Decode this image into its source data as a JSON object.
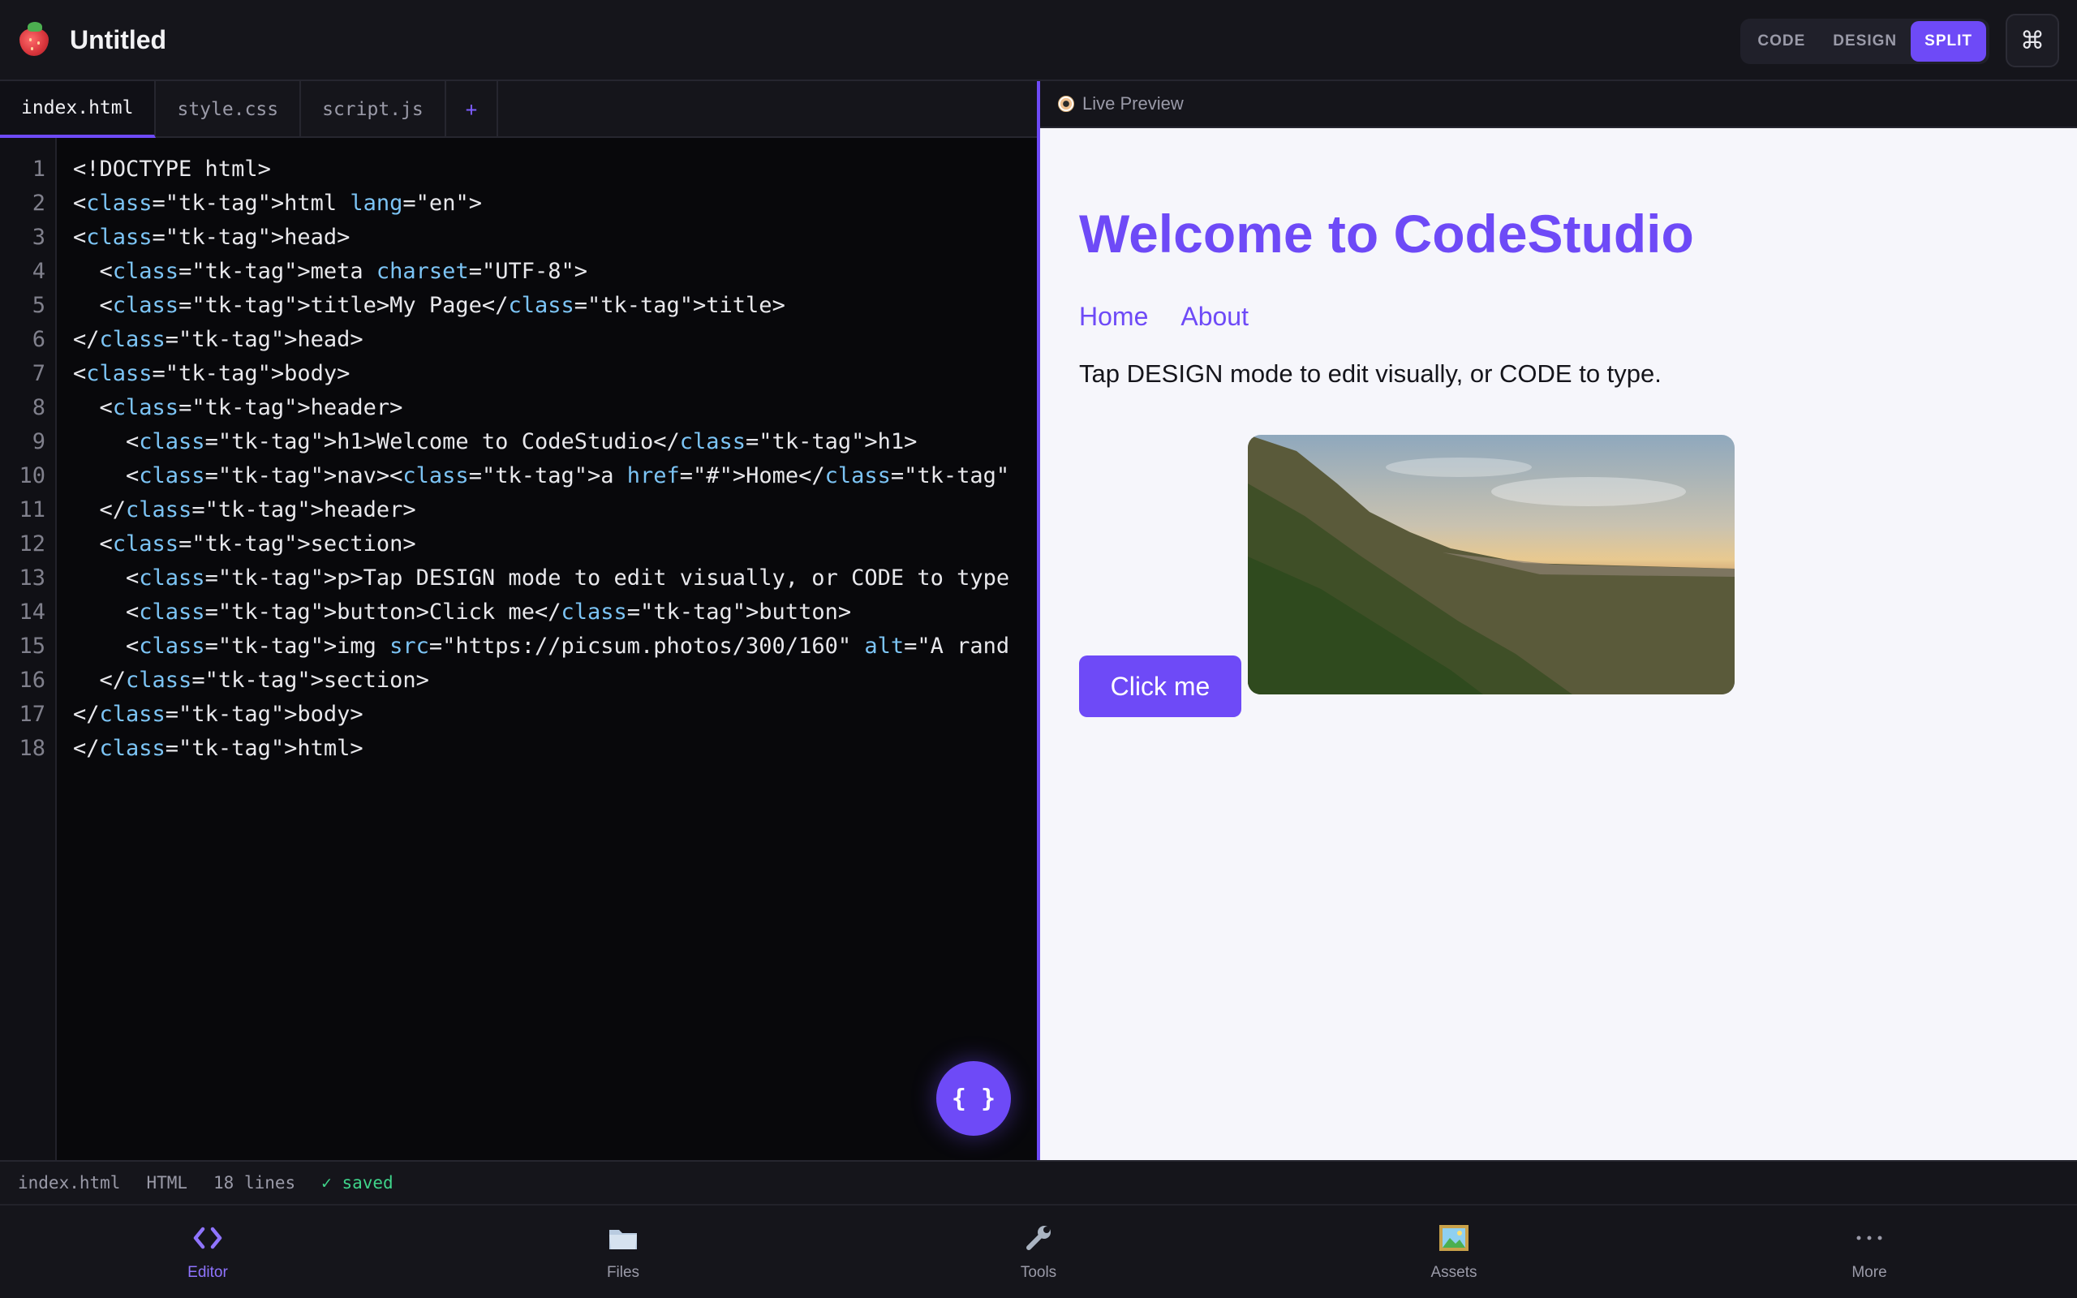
{
  "app": {
    "title": "Untitled"
  },
  "modes": {
    "code": "CODE",
    "design": "DESIGN",
    "split": "SPLIT",
    "active": "split"
  },
  "command_icon": "⌘",
  "tabs": [
    {
      "label": "index.html",
      "active": true
    },
    {
      "label": "style.css",
      "active": false
    },
    {
      "label": "script.js",
      "active": false
    },
    {
      "label": "+",
      "active": false
    }
  ],
  "code_lines": [
    "<!DOCTYPE html>",
    "<class=\"tk-tag\">html lang=\"en\">",
    "<class=\"tk-tag\">head>",
    "  <class=\"tk-tag\">meta charset=\"UTF-8\">",
    "  <class=\"tk-tag\">title>My Page</class=\"tk-tag\">title>",
    "</class=\"tk-tag\">head>",
    "<class=\"tk-tag\">body>",
    "  <class=\"tk-tag\">header>",
    "    <class=\"tk-tag\">h1>Welcome to CodeStudio</class=\"tk-tag\">h1>",
    "    <class=\"tk-tag\">nav><class=\"tk-tag\">a href=\"#\">Home</class=\"tk-tag\"",
    "  </class=\"tk-tag\">header>",
    "  <class=\"tk-tag\">section>",
    "    <class=\"tk-tag\">p>Tap DESIGN mode to edit visually, or CODE to type",
    "    <class=\"tk-tag\">button>Click me</class=\"tk-tag\">button>",
    "    <class=\"tk-tag\">img src=\"https://picsum.photos/300/160\" alt=\"A rand",
    "  </class=\"tk-tag\">section>",
    "</class=\"tk-tag\">body>",
    "</class=\"tk-tag\">html>"
  ],
  "fab_label": "{ }",
  "preview": {
    "header": "Live Preview",
    "h1": "Welcome to CodeStudio",
    "nav": [
      "Home",
      "About"
    ],
    "paragraph": "Tap DESIGN mode to edit visually, or CODE to type.",
    "button": "Click me"
  },
  "status": {
    "file": "index.html",
    "lang": "HTML",
    "lines": "18 lines",
    "saved": "✓ saved"
  },
  "bottom_nav": [
    {
      "label": "Editor",
      "icon": "code-brackets-icon",
      "active": true
    },
    {
      "label": "Files",
      "icon": "folder-icon",
      "active": false
    },
    {
      "label": "Tools",
      "icon": "wrench-icon",
      "active": false
    },
    {
      "label": "Assets",
      "icon": "picture-icon",
      "active": false
    },
    {
      "label": "More",
      "icon": "ellipsis-icon",
      "active": false
    }
  ],
  "colors": {
    "accent": "#6e4af7",
    "saved": "#3fd48a",
    "attr": "#7cc4f5",
    "background": "#08080b"
  }
}
